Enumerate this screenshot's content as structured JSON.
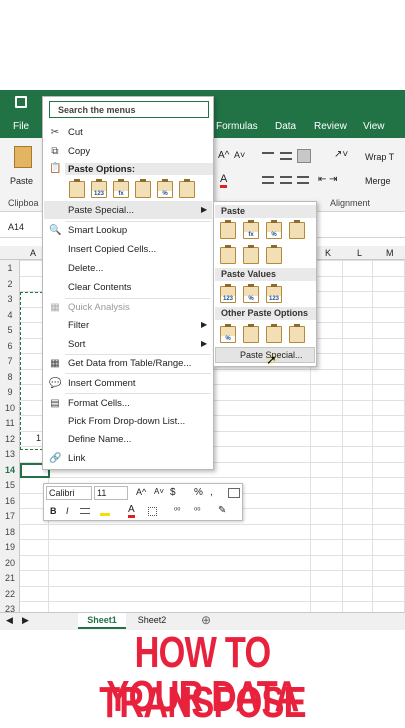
{
  "ribbon": {
    "tabs": [
      "File",
      "Formulas",
      "Data",
      "Review",
      "View"
    ],
    "paste_label": "Paste",
    "clipboard_label": "Clipboa",
    "alignment_label": "Alignment",
    "wrap_text": "Wrap T",
    "merge": "Merge"
  },
  "formula": {
    "namebox": "A14"
  },
  "columns": [
    "A",
    "K",
    "L",
    "M"
  ],
  "rows": [
    "1",
    "2",
    "3",
    "4",
    "5",
    "6",
    "7",
    "8",
    "9",
    "10",
    "11",
    "12",
    "13",
    "14",
    "15",
    "16",
    "17",
    "18",
    "19",
    "20",
    "21",
    "22",
    "23"
  ],
  "cell_a12": "1",
  "context_menu": {
    "search_placeholder": "Search the menus",
    "cut": "Cut",
    "copy": "Copy",
    "paste_options_header": "Paste Options:",
    "paste_special": "Paste Special...",
    "smart_lookup": "Smart Lookup",
    "insert_copied_cells": "Insert Copied Cells...",
    "delete": "Delete...",
    "clear_contents": "Clear Contents",
    "quick_analysis": "Quick Analysis",
    "filter": "Filter",
    "sort": "Sort",
    "get_data": "Get Data from Table/Range...",
    "insert_comment": "Insert Comment",
    "format_cells": "Format Cells...",
    "pick_dropdown": "Pick From Drop-down List...",
    "define_name": "Define Name...",
    "link": "Link"
  },
  "submenu": {
    "paste": "Paste",
    "paste_values": "Paste Values",
    "other_paste_options": "Other Paste Options",
    "paste_special": "Paste Special..."
  },
  "mini_toolbar": {
    "font": "Calibri",
    "size": "11",
    "bold": "B",
    "italic": "I",
    "currency": "$",
    "percent": "%"
  },
  "sheets": [
    "Sheet1",
    "Sheet2"
  ],
  "caption": {
    "line1": "HOW TO TRANSPOSE",
    "line2": "YOUR DATA"
  },
  "colors": {
    "excel_green": "#217346",
    "caption_red": "#e8213d"
  }
}
